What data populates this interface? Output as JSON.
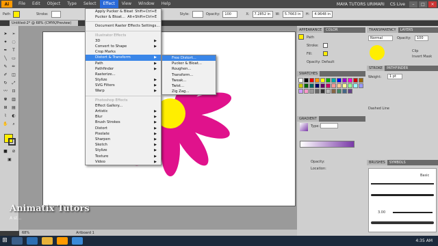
{
  "menubar": {
    "logo": "Ai",
    "items": [
      "File",
      "Edit",
      "Object",
      "Type",
      "Select",
      "Effect",
      "View",
      "Window",
      "Help"
    ],
    "active_index": 5,
    "title": "MAYA TUTORS URIMARI",
    "cslive": "CS Live",
    "win_min": "–",
    "win_max": "□",
    "win_close": "×"
  },
  "controlbar": {
    "path_label": "Path",
    "stroke_label": "Stroke:",
    "style_label": "Style:",
    "opacity_label": "Opacity:",
    "opacity_value": "100",
    "x_label": "X:",
    "x_value": "7.2852 in",
    "w_label": "W:",
    "w_value": "5.7663 in",
    "h_label": "H:",
    "h_value": "4.9648 in",
    "fill_color": "#ffee00"
  },
  "document": {
    "tab": "Untitled-2* @ 68% (CMYK/Preview)"
  },
  "effect_menu": {
    "items": [
      {
        "label": "Apply Pucker & Bloat",
        "shortcut": "Shift+Ctrl+E",
        "type": "item"
      },
      {
        "label": "Pucker & Bloat...",
        "shortcut": "Alt+Shift+Ctrl+E",
        "type": "item"
      },
      {
        "type": "sep"
      },
      {
        "label": "Document Raster Effects Settings...",
        "shortcut": "",
        "type": "item"
      },
      {
        "type": "sep"
      },
      {
        "label": "Illustrator Effects",
        "shortcut": "",
        "type": "hdr"
      },
      {
        "label": "3D",
        "shortcut": "▶",
        "type": "item"
      },
      {
        "label": "Convert to Shape",
        "shortcut": "▶",
        "type": "item"
      },
      {
        "label": "Crop Marks",
        "shortcut": "",
        "type": "item"
      },
      {
        "label": "Distort & Transform",
        "shortcut": "▶",
        "type": "hl"
      },
      {
        "label": "Path",
        "shortcut": "▶",
        "type": "item"
      },
      {
        "label": "Pathfinder",
        "shortcut": "▶",
        "type": "item"
      },
      {
        "label": "Rasterize...",
        "shortcut": "",
        "type": "item"
      },
      {
        "label": "Stylize",
        "shortcut": "▶",
        "type": "item"
      },
      {
        "label": "SVG Filters",
        "shortcut": "▶",
        "type": "item"
      },
      {
        "label": "Warp",
        "shortcut": "▶",
        "type": "item"
      },
      {
        "type": "sep"
      },
      {
        "label": "Photoshop Effects",
        "shortcut": "",
        "type": "hdr"
      },
      {
        "label": "Effect Gallery...",
        "shortcut": "",
        "type": "item"
      },
      {
        "label": "Artistic",
        "shortcut": "▶",
        "type": "item"
      },
      {
        "label": "Blur",
        "shortcut": "▶",
        "type": "item"
      },
      {
        "label": "Brush Strokes",
        "shortcut": "▶",
        "type": "item"
      },
      {
        "label": "Distort",
        "shortcut": "▶",
        "type": "item"
      },
      {
        "label": "Pixelate",
        "shortcut": "▶",
        "type": "item"
      },
      {
        "label": "Sharpen",
        "shortcut": "▶",
        "type": "item"
      },
      {
        "label": "Sketch",
        "shortcut": "▶",
        "type": "item"
      },
      {
        "label": "Stylize",
        "shortcut": "▶",
        "type": "item"
      },
      {
        "label": "Texture",
        "shortcut": "▶",
        "type": "item"
      },
      {
        "label": "Video",
        "shortcut": "▶",
        "type": "item"
      }
    ]
  },
  "submenu": {
    "items": [
      {
        "label": "Free Distort...",
        "type": "hl"
      },
      {
        "label": "Pucker & Bloat...",
        "type": "item"
      },
      {
        "label": "Roughen...",
        "type": "item"
      },
      {
        "label": "Transform...",
        "type": "item"
      },
      {
        "label": "Tweak...",
        "type": "item"
      },
      {
        "label": "Twist...",
        "type": "item"
      },
      {
        "label": "Zig Zag...",
        "type": "item"
      }
    ]
  },
  "appearance_panel": {
    "tabs": [
      "APPEARANCE",
      "COLOR"
    ],
    "row_path": "Path",
    "row_stroke": "Stroke:",
    "row_fill": "Fill:",
    "row_opacity": "Opacity: Default"
  },
  "transparency_panel": {
    "tabs": [
      "TRANSPARENCY",
      "LAYERS"
    ],
    "mode": "Normal",
    "opacity_label": "Opacity:",
    "opacity_value": "100",
    "clip": "Clip",
    "invert": "Invert Mask"
  },
  "swatches_panel": {
    "tabs": [
      "SWATCHES"
    ]
  },
  "stroke_panel": {
    "tabs": [
      "STROKE",
      "PATHFINDER"
    ],
    "weight_label": "Weight:",
    "weight_value": "1 pt",
    "dashed_label": "Dashed Line"
  },
  "gradient_panel": {
    "tabs": [
      "GRADIENT"
    ],
    "type_label": "Type:",
    "opacity_label": "Opacity:",
    "location_label": "Location:"
  },
  "brushes_panel": {
    "tabs": [
      "BRUSHES",
      "SYMBOLS"
    ],
    "basic": "Basic",
    "size": "3.00"
  },
  "status": {
    "zoom": "68%",
    "artboard": "Artboard 1"
  },
  "taskbar": {
    "time": "4:35 AM"
  },
  "watermark": {
    "line1": "Animatix Tutors",
    "line2": "A st..."
  },
  "colors": {
    "flower_petal": "#e0128c",
    "flower_center": "#ffee00",
    "highlight": "#3a86e8"
  }
}
